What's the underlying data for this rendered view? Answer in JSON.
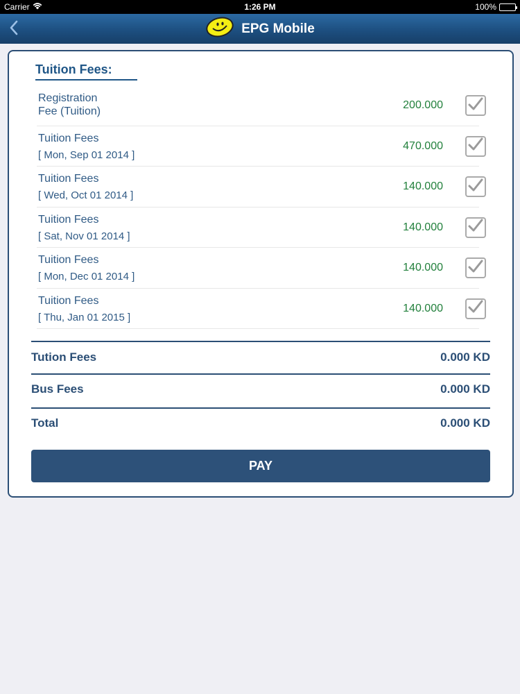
{
  "status_bar": {
    "carrier": "Carrier",
    "time": "1:26 PM",
    "battery": "100%",
    "battery_level": 1.0
  },
  "nav": {
    "title": "EPG Mobile",
    "back_icon": "chevron-left-icon",
    "logo_icon": "smiley-logo-icon",
    "colors": {
      "bar": "#1d4f80",
      "logo": "#f4ee14"
    }
  },
  "fees": {
    "section_title": "Tuition Fees:",
    "items": [
      {
        "name": "Registration\nFee (Tuition)",
        "date": "",
        "amount": "200.000",
        "checked": true
      },
      {
        "name": "Tuition Fees",
        "date": "[ Mon, Sep 01 2014 ]",
        "amount": "470.000",
        "checked": true
      },
      {
        "name": "Tuition Fees",
        "date": "[ Wed, Oct 01 2014 ]",
        "amount": "140.000",
        "checked": true
      },
      {
        "name": "Tuition Fees",
        "date": "[ Sat, Nov 01 2014 ]",
        "amount": "140.000",
        "checked": true
      },
      {
        "name": "Tuition Fees",
        "date": "[ Mon, Dec 01 2014 ]",
        "amount": "140.000",
        "checked": true
      },
      {
        "name": "Tuition Fees",
        "date": "[ Thu, Jan 01 2015 ]",
        "amount": "140.000",
        "checked": true
      }
    ]
  },
  "summary": {
    "tuition_label": "Tution Fees",
    "tuition_value": "0.000 KD",
    "bus_label": "Bus Fees",
    "bus_value": "0.000 KD",
    "total_label": "Total",
    "total_value": "0.000 KD"
  },
  "pay_button_label": "PAY",
  "colors": {
    "accent": "#2b4e75",
    "amount": "#22803c",
    "text": "#2f5a85"
  }
}
